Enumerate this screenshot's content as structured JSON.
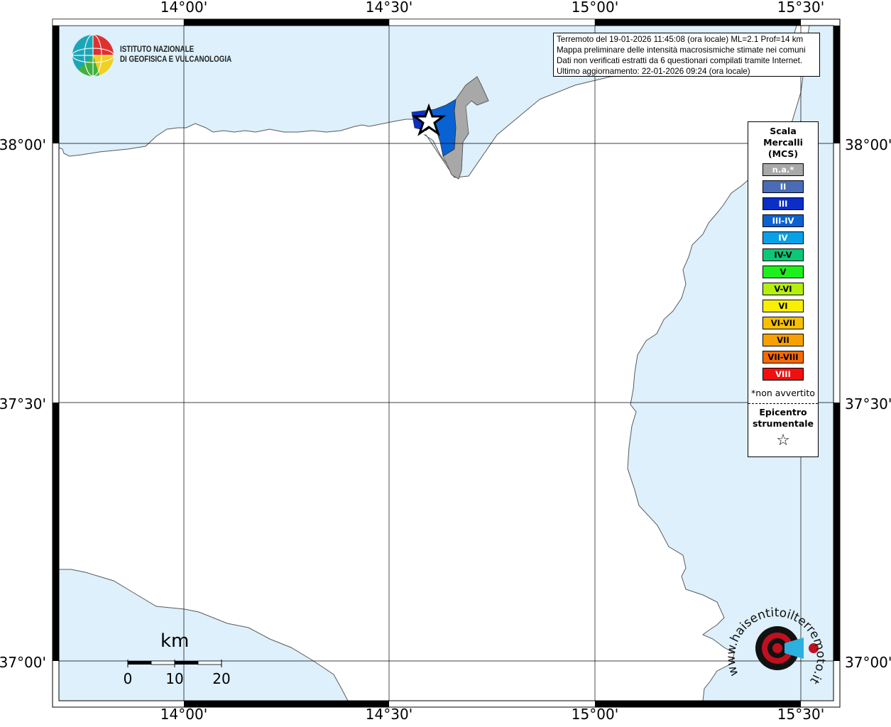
{
  "map": {
    "title_box": {
      "lines": [
        "Terremoto del 19-01-2026 11:45:08 (ora locale) ML=2.1 Prof=14 km",
        "Mappa preliminare delle intensità macrosismiche stimate nei comuni",
        "Dati non verificati estratti da 6 questionari compilati tramite Internet.",
        "Ultimo aggiornamento: 22-01-2026 09:24 (ora locale)"
      ]
    },
    "axes": {
      "longitudes": [
        "14°00'",
        "14°30'",
        "15°00'",
        "15°30'"
      ],
      "latitudes": [
        "38°00'",
        "37°30'",
        "37°00'"
      ]
    },
    "colors": {
      "sea": "#ddf0fb",
      "land": "#ffffff",
      "coast": "#5a5a5a",
      "grid": "#000000"
    }
  },
  "institute": {
    "name_line1": "ISTITUTO NAZIONALE",
    "name_line2": "DI GEOFISICA E VULCANOLOGIA"
  },
  "legend": {
    "title_lines": [
      "Scala",
      "Mercalli",
      "(MCS)"
    ],
    "items": [
      {
        "label": "n.a.*",
        "color": "#a8a8a8",
        "text_color": "#ffffff"
      },
      {
        "label": "II",
        "color": "#4a6cb8",
        "text_color": "#ffffff"
      },
      {
        "label": "III",
        "color": "#0a2ec8",
        "text_color": "#ffffff"
      },
      {
        "label": "III-IV",
        "color": "#0a62d2",
        "text_color": "#ffffff"
      },
      {
        "label": "IV",
        "color": "#0aa0e8",
        "text_color": "#ffffff"
      },
      {
        "label": "IV-V",
        "color": "#0ac878",
        "text_color": "#000000"
      },
      {
        "label": "V",
        "color": "#1ef01e",
        "text_color": "#000000"
      },
      {
        "label": "V-VI",
        "color": "#b4f00a",
        "text_color": "#000000"
      },
      {
        "label": "VI",
        "color": "#f8f000",
        "text_color": "#000000"
      },
      {
        "label": "VI-VII",
        "color": "#f8c000",
        "text_color": "#000000"
      },
      {
        "label": "VII",
        "color": "#f8a000",
        "text_color": "#000000"
      },
      {
        "label": "VII-VIII",
        "color": "#f86a00",
        "text_color": "#000000"
      },
      {
        "label": "VIII",
        "color": "#f01010",
        "text_color": "#ffffff"
      }
    ],
    "note": "*non avvertito",
    "epicenter_lines": [
      "Epicentro",
      "strumentale"
    ],
    "epicenter_symbol": "☆"
  },
  "scale_bar": {
    "title": "km",
    "ticks": [
      "0",
      "10",
      "20"
    ]
  },
  "watermark": {
    "text": "www.haisentitoilterremoto.it"
  }
}
